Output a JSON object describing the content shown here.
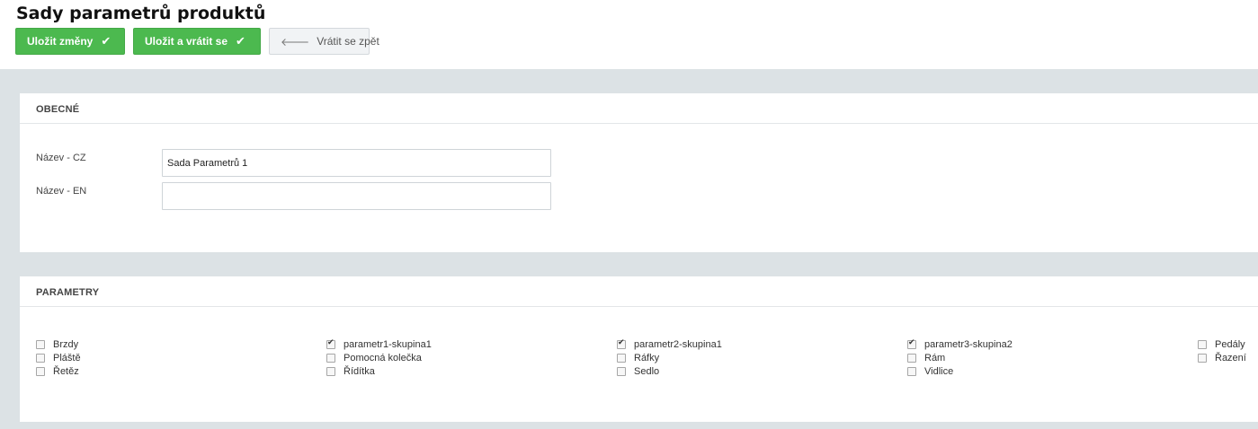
{
  "header": {
    "title": "Sady parametrů produktů",
    "save_label": "Uložit změny",
    "save_return_label": "Uložit a vrátit se",
    "back_label": "Vrátit se zpět"
  },
  "general": {
    "title": "OBECNÉ",
    "name_cz_label": "Název - CZ",
    "name_cz_value": "Sada Parametrů 1",
    "name_en_label": "Název - EN",
    "name_en_value": ""
  },
  "params": {
    "title": "PARAMETRY",
    "columns": [
      [
        {
          "label": "Brzdy",
          "checked": false
        },
        {
          "label": "Pláště",
          "checked": false
        },
        {
          "label": "Řetěz",
          "checked": false
        }
      ],
      [
        {
          "label": "parametr1-skupina1",
          "checked": true
        },
        {
          "label": "Pomocná kolečka",
          "checked": false
        },
        {
          "label": "Řídítka",
          "checked": false
        }
      ],
      [
        {
          "label": "parametr2-skupina1",
          "checked": true
        },
        {
          "label": "Ráfky",
          "checked": false
        },
        {
          "label": "Sedlo",
          "checked": false
        }
      ],
      [
        {
          "label": "parametr3-skupina2",
          "checked": true
        },
        {
          "label": "Rám",
          "checked": false
        },
        {
          "label": "Vidlice",
          "checked": false
        }
      ],
      [
        {
          "label": "Pedály",
          "checked": false
        },
        {
          "label": "Řazení",
          "checked": false
        }
      ]
    ]
  }
}
